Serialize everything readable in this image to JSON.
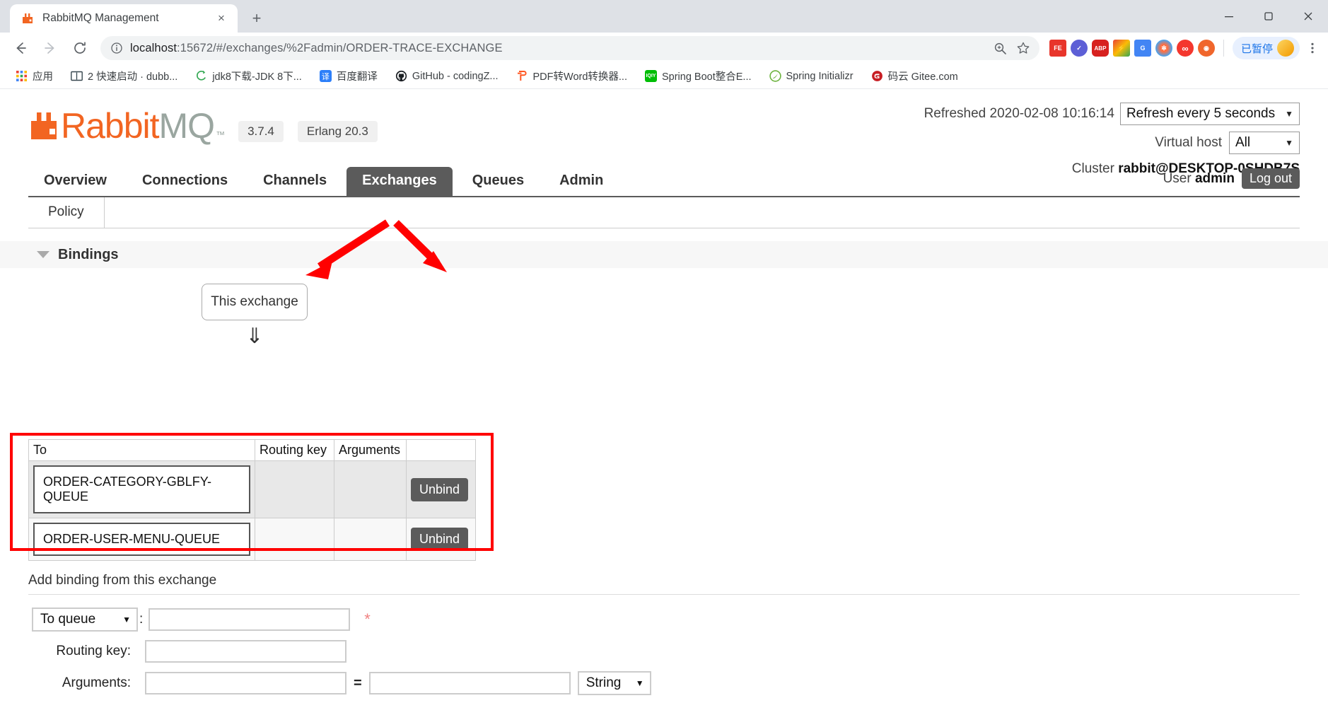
{
  "browser": {
    "tab": {
      "title": "RabbitMQ Management",
      "favicon": "rabbitmq-icon",
      "close": "×"
    },
    "newtab_label": "+",
    "window_controls": {
      "minimize": "─",
      "maximize": "❐",
      "close": "✕"
    },
    "nav": {
      "back": "←",
      "forward": "→",
      "reload": "↻"
    },
    "omnibox": {
      "info_icon": "info-icon",
      "url_host": "localhost",
      "url_path": ":15672/#/exchanges/%2Fadmin/ORDER-TRACE-EXCHANGE",
      "zoom_icon": "zoom-search-icon",
      "bookmark_icon": "star-icon"
    },
    "extensions": [
      {
        "name": "fe-helper-extension",
        "label": "FE",
        "color": "#e8352b"
      },
      {
        "name": "check-extension",
        "label": "✔",
        "color": "#5d5fd6"
      },
      {
        "name": "adblock-plus-extension",
        "label": "ABP",
        "color": "#d7211f"
      },
      {
        "name": "flash-extension",
        "label": "⚡",
        "color": "#fbbc05"
      },
      {
        "name": "google-translate-extension",
        "label": "G",
        "color": "#4285f4"
      },
      {
        "name": "colorful-extension",
        "label": "✿",
        "color": "#ff7043"
      },
      {
        "name": "infinity-extension",
        "label": "∞",
        "color": "#f4372e"
      },
      {
        "name": "orange-extension",
        "label": "◉",
        "color": "#f0662c"
      }
    ],
    "paused": {
      "label": "已暂停",
      "avatar": "profile-avatar"
    },
    "bookmarks": [
      {
        "name": "apps",
        "label": "应用",
        "icon": "apps-grid-icon",
        "color": "#4285f4"
      },
      {
        "name": "dubbo-quickstart",
        "label": "2 快速启动 · dubb...",
        "icon": "book-icon",
        "color": "#37474f"
      },
      {
        "name": "jdk8-download",
        "label": "jdk8下载-JDK 8下...",
        "icon": "java-icon",
        "color": "#34a853"
      },
      {
        "name": "baidu-translate",
        "label": "百度翻译",
        "icon": "translate-icon",
        "color": "#2d7ff9"
      },
      {
        "name": "github-codingz",
        "label": "GitHub - codingZ...",
        "icon": "github-icon",
        "color": "#1b1f23"
      },
      {
        "name": "pdf-to-word",
        "label": "PDF转Word转换器...",
        "icon": "pdf-icon",
        "color": "#ff5722"
      },
      {
        "name": "spring-boot-integration",
        "label": "Spring Boot整合E...",
        "icon": "iqiyi-icon",
        "color": "#00be06"
      },
      {
        "name": "spring-initializr",
        "label": "Spring Initializr",
        "icon": "spring-leaf-icon",
        "color": "#6db33f"
      },
      {
        "name": "gitee",
        "label": "码云 Gitee.com",
        "icon": "gitee-icon",
        "color": "#c71d23"
      }
    ]
  },
  "app": {
    "logo": {
      "text_primary": "Rabbit",
      "text_secondary": "MQ",
      "tm": "™"
    },
    "version": "3.7.4",
    "erlang": "Erlang 20.3",
    "header": {
      "refreshed_label": "Refreshed 2020-02-08 10:16:14",
      "refresh_select": {
        "value": "Refresh every 5 seconds",
        "caret": "▼"
      },
      "vhost_label": "Virtual host",
      "vhost_select": {
        "value": "All",
        "caret": "▼"
      },
      "cluster_label": "Cluster",
      "cluster_value": "rabbit@DESKTOP-0SHDB7S",
      "user_label": "User",
      "user_value": "admin",
      "logout_label": "Log out"
    },
    "nav_tabs": [
      {
        "name": "tab-overview",
        "label": "Overview",
        "active": false
      },
      {
        "name": "tab-connections",
        "label": "Connections",
        "active": false
      },
      {
        "name": "tab-channels",
        "label": "Channels",
        "active": false
      },
      {
        "name": "tab-exchanges",
        "label": "Exchanges",
        "active": true
      },
      {
        "name": "tab-queues",
        "label": "Queues",
        "active": false
      },
      {
        "name": "tab-admin",
        "label": "Admin",
        "active": false
      }
    ],
    "sub_tabs": [
      {
        "name": "subtab-policy",
        "label": "Policy"
      }
    ],
    "bindings_section": {
      "title": "Bindings",
      "toggle": "collapse-triangle-icon",
      "this_exchange_label": "This exchange",
      "down_arrow": "⇓",
      "columns": [
        "To",
        "Routing key",
        "Arguments",
        ""
      ],
      "rows": [
        {
          "to": "ORDER-CATEGORY-GBLFY-QUEUE",
          "routing_key": "",
          "arguments": "",
          "action": "Unbind"
        },
        {
          "to": "ORDER-USER-MENU-QUEUE",
          "routing_key": "",
          "arguments": "",
          "action": "Unbind"
        }
      ]
    },
    "add_binding": {
      "title": "Add binding from this exchange",
      "destination_select": {
        "value": "To queue",
        "caret": "▼"
      },
      "destination_colon": ":",
      "destination_value": "",
      "destination_placeholder": "",
      "required_marker": "*",
      "routing_key_label": "Routing key:",
      "routing_key_value": "",
      "arguments_label": "Arguments:",
      "arguments_key_value": "",
      "equals": "=",
      "arguments_val_value": "",
      "type_select": {
        "value": "String",
        "caret": "▼"
      }
    }
  },
  "annotations": {
    "highlight_color": "#ff0000",
    "arrow_count": 2
  }
}
